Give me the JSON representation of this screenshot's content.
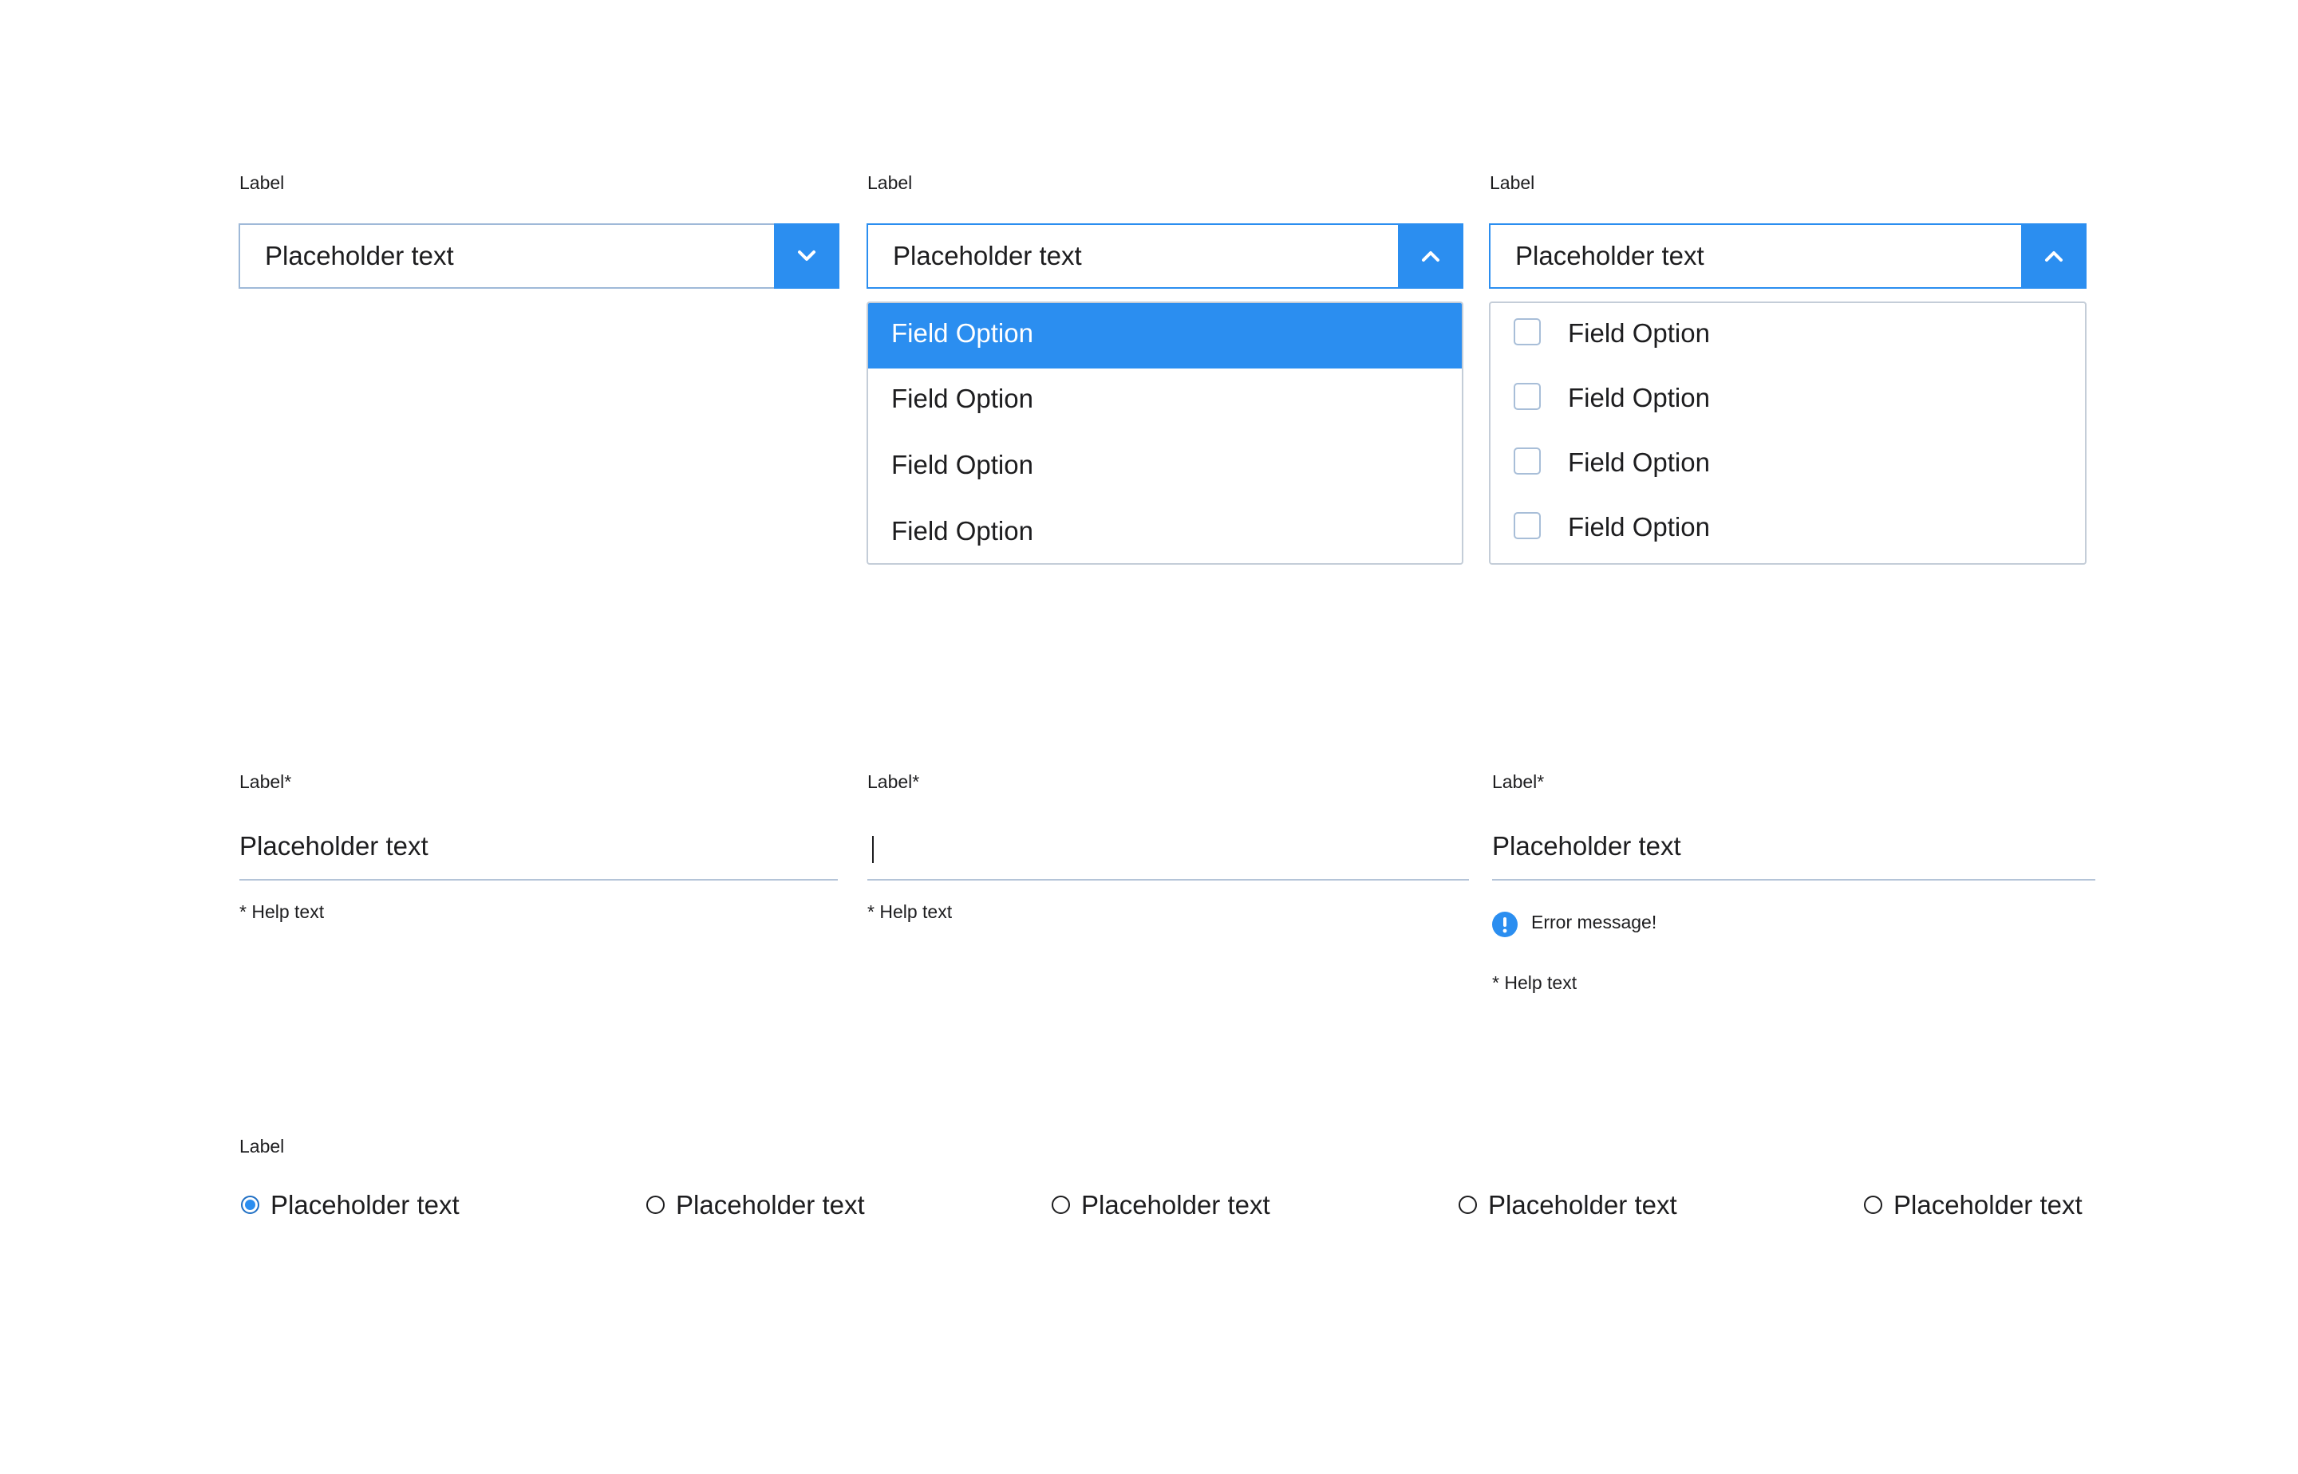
{
  "colors": {
    "accent": "#2b8ef0",
    "border": "#9fb9d8",
    "text": "#1d1d1f"
  },
  "selects": [
    {
      "label": "Label",
      "value": "Placeholder text",
      "toggle_icon": "chevron-down-icon",
      "state": "closed"
    },
    {
      "label": "Label",
      "value": "Placeholder text",
      "toggle_icon": "chevron-up-icon",
      "state": "open",
      "options": [
        {
          "label": "Field Option",
          "selected": true
        },
        {
          "label": "Field Option",
          "selected": false
        },
        {
          "label": "Field Option",
          "selected": false
        },
        {
          "label": "Field Option",
          "selected": false
        }
      ]
    },
    {
      "label": "Label",
      "value": "Placeholder text",
      "toggle_icon": "chevron-up-icon",
      "state": "open-multi",
      "options": [
        {
          "label": "Field Option",
          "checked": false
        },
        {
          "label": "Field Option",
          "checked": false
        },
        {
          "label": "Field Option",
          "checked": false
        },
        {
          "label": "Field Option",
          "checked": false
        }
      ]
    }
  ],
  "text_inputs": [
    {
      "label": "Label*",
      "value": "Placeholder text",
      "help": "* Help text"
    },
    {
      "label": "Label*",
      "value": "",
      "help": "* Help text",
      "focused": true
    },
    {
      "label": "Label*",
      "value": "Placeholder text",
      "error": "Error message!",
      "error_icon": "exclamation-icon",
      "help": "* Help text"
    }
  ],
  "radio_group": {
    "label": "Label",
    "options": [
      {
        "label": "Placeholder text",
        "checked": true
      },
      {
        "label": "Placeholder text",
        "checked": false
      },
      {
        "label": "Placeholder text",
        "checked": false
      },
      {
        "label": "Placeholder text",
        "checked": false
      },
      {
        "label": "Placeholder text",
        "checked": false
      }
    ]
  }
}
